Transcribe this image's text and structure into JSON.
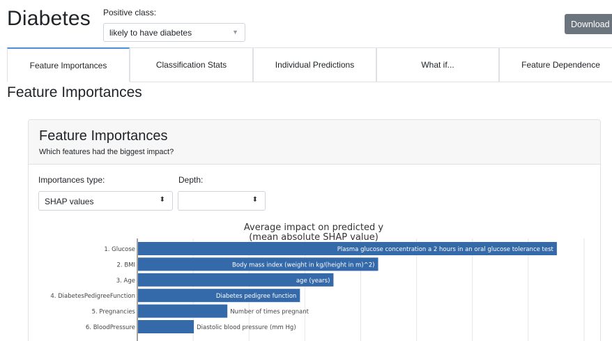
{
  "header": {
    "title": "Diabetes",
    "positive_class_label": "Positive class:",
    "positive_class_value": "likely to have diabetes",
    "download_label": "Download"
  },
  "tabs": [
    {
      "label": "Feature Importances",
      "active": true
    },
    {
      "label": "Classification Stats",
      "active": false
    },
    {
      "label": "Individual Predictions",
      "active": false
    },
    {
      "label": "What if...",
      "active": false
    },
    {
      "label": "Feature Dependence",
      "active": false
    }
  ],
  "section_title": "Feature Importances",
  "card": {
    "title": "Feature Importances",
    "subtitle": "Which features had the biggest impact?",
    "importances_type_label": "Importances type:",
    "importances_type_value": "SHAP values",
    "depth_label": "Depth:",
    "depth_value": ""
  },
  "colors": {
    "bar": "#3469aa",
    "download_button": "#6c757d",
    "active_tab_accent": "#4a90d9"
  },
  "chart_data": {
    "type": "bar",
    "orientation": "horizontal",
    "title": "Average impact on predicted y\n(mean absolute SHAP value)",
    "categories": [
      "1. Glucose",
      "2. BMI",
      "3. Age",
      "4. DiabetesPedigreeFunction",
      "5. Pregnancies",
      "6. BloodPressure"
    ],
    "values": [
      7.5,
      4.3,
      3.5,
      2.9,
      1.6,
      1.0
    ],
    "bar_labels": [
      "Plasma glucose concentration a 2 hours in an oral glucose tolerance test",
      "Body mass index (weight in kg/(height in m)^2)",
      "age (years)",
      "Diabetes pedigree function",
      "Number of times pregnant",
      "Diastolic blood pressure (mm Hg)"
    ],
    "xlim": [
      0,
      8.5
    ],
    "grid": true
  }
}
